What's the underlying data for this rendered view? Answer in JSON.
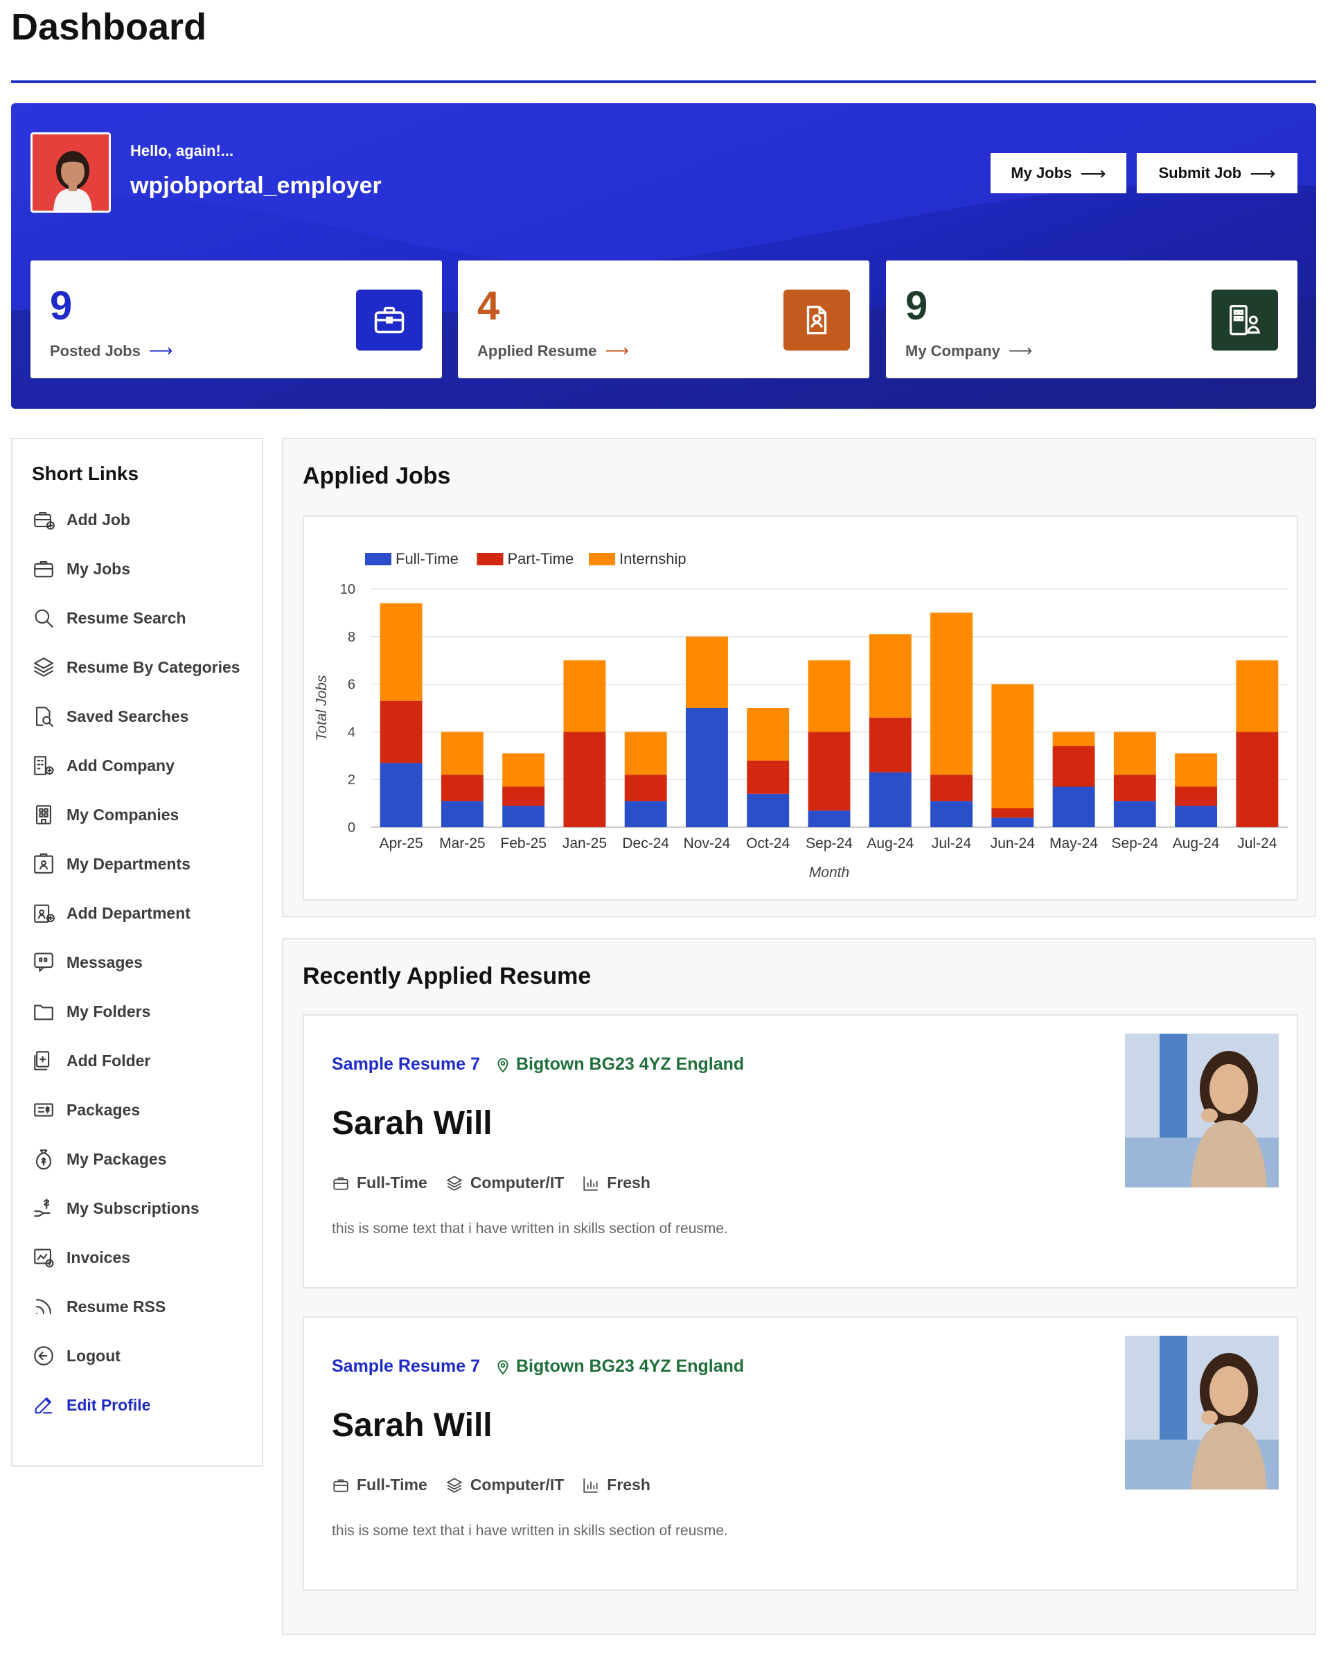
{
  "page": {
    "title": "Dashboard"
  },
  "header": {
    "greeting": "Hello, again!...",
    "username": "wpjobportal_employer",
    "buttons": [
      {
        "label": "My Jobs"
      },
      {
        "label": "Submit Job"
      }
    ]
  },
  "stats": [
    {
      "value": "9",
      "label": "Posted Jobs",
      "color": "#1f2bc8",
      "icon": "briefcase-icon"
    },
    {
      "value": "4",
      "label": "Applied Resume",
      "color": "#c35a1e",
      "icon": "resume-icon"
    },
    {
      "value": "9",
      "label": "My Company",
      "color": "#1f3d2b",
      "icon": "company-icon"
    }
  ],
  "sidebar": {
    "title": "Short Links",
    "items": [
      {
        "label": "Add Job",
        "icon": "add-job-icon"
      },
      {
        "label": "My Jobs",
        "icon": "briefcase-icon"
      },
      {
        "label": "Resume Search",
        "icon": "search-icon"
      },
      {
        "label": "Resume By Categories",
        "icon": "layers-icon"
      },
      {
        "label": "Saved Searches",
        "icon": "saved-search-icon"
      },
      {
        "label": "Add Company",
        "icon": "add-company-icon"
      },
      {
        "label": "My Companies",
        "icon": "building-icon"
      },
      {
        "label": "My Departments",
        "icon": "department-icon"
      },
      {
        "label": "Add Department",
        "icon": "add-department-icon"
      },
      {
        "label": "Messages",
        "icon": "message-icon"
      },
      {
        "label": "My Folders",
        "icon": "folder-icon"
      },
      {
        "label": "Add Folder",
        "icon": "add-folder-icon"
      },
      {
        "label": "Packages",
        "icon": "package-icon"
      },
      {
        "label": "My Packages",
        "icon": "money-bag-icon"
      },
      {
        "label": "My Subscriptions",
        "icon": "subscription-icon"
      },
      {
        "label": "Invoices",
        "icon": "invoice-icon"
      },
      {
        "label": "Resume RSS",
        "icon": "rss-icon"
      },
      {
        "label": "Logout",
        "icon": "logout-icon"
      },
      {
        "label": "Edit Profile",
        "icon": "edit-icon"
      }
    ]
  },
  "applied_jobs": {
    "title": "Applied Jobs"
  },
  "chart_data": {
    "type": "bar",
    "stacked": true,
    "categories": [
      "Apr-25",
      "Mar-25",
      "Feb-25",
      "Jan-25",
      "Dec-24",
      "Nov-24",
      "Oct-24",
      "Sep-24",
      "Aug-24",
      "Jul-24",
      "Jun-24",
      "May-24",
      "Sep-24",
      "Aug-24",
      "Jul-24"
    ],
    "series": [
      {
        "name": "Full-Time",
        "color": "#2a4fc9",
        "values": [
          2.7,
          1.1,
          0.9,
          0,
          1.1,
          5,
          1.4,
          0.7,
          2.3,
          1.1,
          0.4,
          1.7,
          1.1,
          0.9,
          0
        ]
      },
      {
        "name": "Part-Time",
        "color": "#d2280f",
        "values": [
          2.6,
          1.1,
          0.8,
          4,
          1.1,
          0,
          1.4,
          3.3,
          2.3,
          1.1,
          0.4,
          1.7,
          1.1,
          0.8,
          4
        ]
      },
      {
        "name": "Internship",
        "color": "#ff8a00",
        "values": [
          4.1,
          1.8,
          1.4,
          3,
          1.8,
          3,
          2.2,
          3,
          3.5,
          6.8,
          5.2,
          0.6,
          1.8,
          1.4,
          3
        ]
      }
    ],
    "xlabel": "Month",
    "ylabel": "Total Jobs",
    "ylim": [
      0,
      10
    ],
    "yticks": [
      "0",
      "2",
      "4",
      "6",
      "8",
      "10"
    ],
    "grid": true,
    "legend": "top-left"
  },
  "recent": {
    "title": "Recently Applied Resume",
    "resumes": [
      {
        "title": "Sample Resume 7",
        "location": "Bigtown BG23 4YZ England",
        "name": "Sarah Will",
        "tags": [
          "Full-Time",
          "Computer/IT",
          "Fresh"
        ],
        "text": "this is some text that i have written in skills section of reusme."
      },
      {
        "title": "Sample Resume 7",
        "location": "Bigtown BG23 4YZ England",
        "name": "Sarah Will",
        "tags": [
          "Full-Time",
          "Computer/IT",
          "Fresh"
        ],
        "text": "this is some text that i have written in skills section of reusme."
      }
    ]
  }
}
